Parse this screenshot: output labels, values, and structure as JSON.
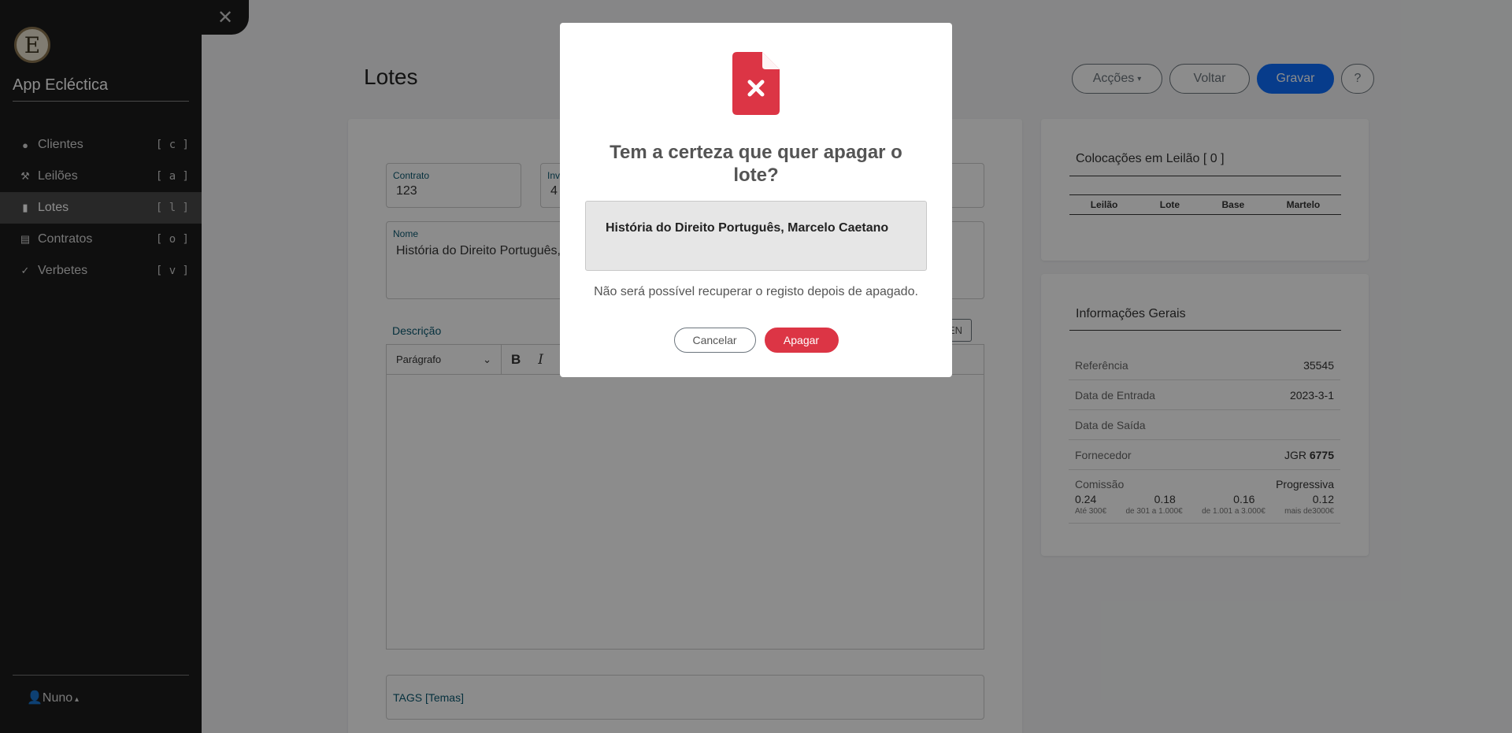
{
  "sidebar": {
    "logo_letter": "E",
    "app_title": "App Ecléctica",
    "items": [
      {
        "icon": "user-circle-icon",
        "label": "Clientes",
        "key": "[ c ]"
      },
      {
        "icon": "gavel-icon",
        "label": "Leilões",
        "key": "[ a ]"
      },
      {
        "icon": "book-icon",
        "label": "Lotes",
        "key": "[ l ]"
      },
      {
        "icon": "file-icon",
        "label": "Contratos",
        "key": "[ o ]"
      },
      {
        "icon": "spell-check-icon",
        "label": "Verbetes",
        "key": "[ v ]"
      }
    ],
    "user": "Nuno",
    "close_symbol": "✕"
  },
  "header": {
    "title": "Lotes",
    "actions_label": "Acções",
    "back_label": "Voltar",
    "save_label": "Gravar",
    "help_label": "?"
  },
  "form": {
    "contrato_label": "Contrato",
    "contrato_value": "123",
    "inv_label": "Inv",
    "inv_value": "4",
    "nome_label": "Nome",
    "nome_value": "História do Direito Português,",
    "descricao_label": "Descrição",
    "lang_button": "EN",
    "editor_format": "Parágrafo",
    "tags_label": "TAGS [Temas]"
  },
  "colocacoes": {
    "title": "Colocações em Leilão [ 0 ]",
    "columns": [
      "Leilão",
      "Lote",
      "Base",
      "Martelo"
    ]
  },
  "info": {
    "title": "Informações Gerais",
    "rows": [
      {
        "k": "Referência",
        "v": "35545"
      },
      {
        "k": "Data de Entrada",
        "v": "2023-3-1"
      },
      {
        "k": "Data de Saída",
        "v": ""
      },
      {
        "k": "Fornecedor",
        "v": "JGR",
        "v_bold": "6775"
      }
    ],
    "comissao_label": "Comissão",
    "comissao_type": "Progressiva",
    "comissao_values": [
      "0.24",
      "0.18",
      "0.16",
      "0.12"
    ],
    "comissao_ranges": [
      "Até 300€",
      "de 301 a 1.000€",
      "de 1.001 a 3.000€",
      "mais de3000€"
    ]
  },
  "modal": {
    "title": "Tem a certeza que quer apagar o lote?",
    "item_name": "História do Direito Português, Marcelo Caetano",
    "note": "Não será possível recuperar o registo depois de apagado.",
    "cancel_label": "Cancelar",
    "delete_label": "Apagar",
    "accent_color": "#dc3545"
  }
}
